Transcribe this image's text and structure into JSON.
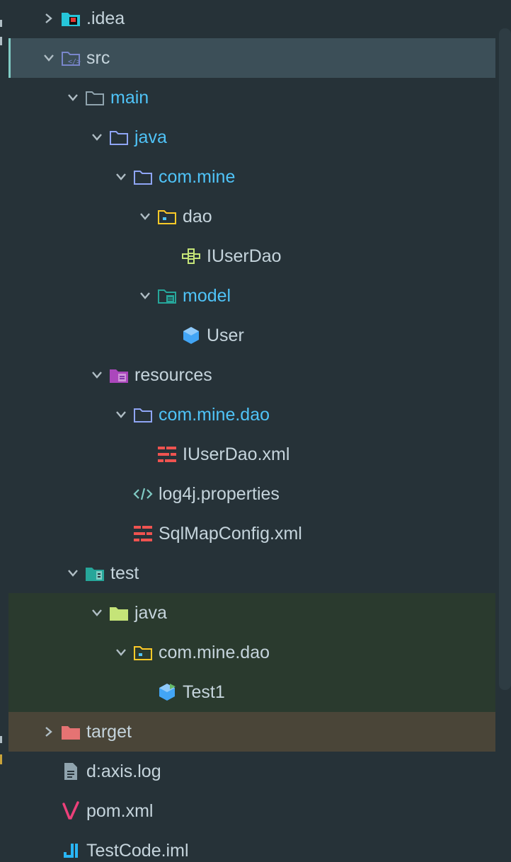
{
  "colors": {
    "background": "#263238",
    "selected_row": "#3c4f58",
    "test_highlight": "#2a3a2e",
    "excluded_highlight": "#4a4538",
    "source_label": "#4fc3f7",
    "default_label": "#b0bec5"
  },
  "tree": {
    "items": [
      {
        "label": ".idea",
        "icon": "idea-folder-icon",
        "expanded": false
      },
      {
        "label": "src",
        "icon": "source-folder-icon",
        "expanded": true,
        "selected": true
      },
      {
        "label": "main",
        "icon": "folder-icon",
        "expanded": true
      },
      {
        "label": "java",
        "icon": "folder-icon",
        "expanded": true
      },
      {
        "label": "com.mine",
        "icon": "package-folder-icon",
        "expanded": true
      },
      {
        "label": "dao",
        "icon": "package-icon",
        "expanded": true
      },
      {
        "label": "IUserDao",
        "icon": "interface-icon"
      },
      {
        "label": "model",
        "icon": "model-folder-icon",
        "expanded": true
      },
      {
        "label": "User",
        "icon": "class-icon"
      },
      {
        "label": "resources",
        "icon": "resources-folder-icon",
        "expanded": true
      },
      {
        "label": "com.mine.dao",
        "icon": "package-folder-icon",
        "expanded": true
      },
      {
        "label": "IUserDao.xml",
        "icon": "xml-file-icon"
      },
      {
        "label": "log4j.properties",
        "icon": "properties-file-icon"
      },
      {
        "label": "SqlMapConfig.xml",
        "icon": "xml-file-icon"
      },
      {
        "label": "test",
        "icon": "test-folder-icon",
        "expanded": true
      },
      {
        "label": "java",
        "icon": "test-java-folder-icon",
        "expanded": true
      },
      {
        "label": "com.mine.dao",
        "icon": "package-icon",
        "expanded": true
      },
      {
        "label": "Test1",
        "icon": "test-class-icon"
      },
      {
        "label": "target",
        "icon": "excluded-folder-icon",
        "expanded": false
      },
      {
        "label": "d:axis.log",
        "icon": "log-file-icon"
      },
      {
        "label": "pom.xml",
        "icon": "maven-file-icon"
      },
      {
        "label": "TestCode.iml",
        "icon": "iml-file-icon"
      }
    ]
  }
}
